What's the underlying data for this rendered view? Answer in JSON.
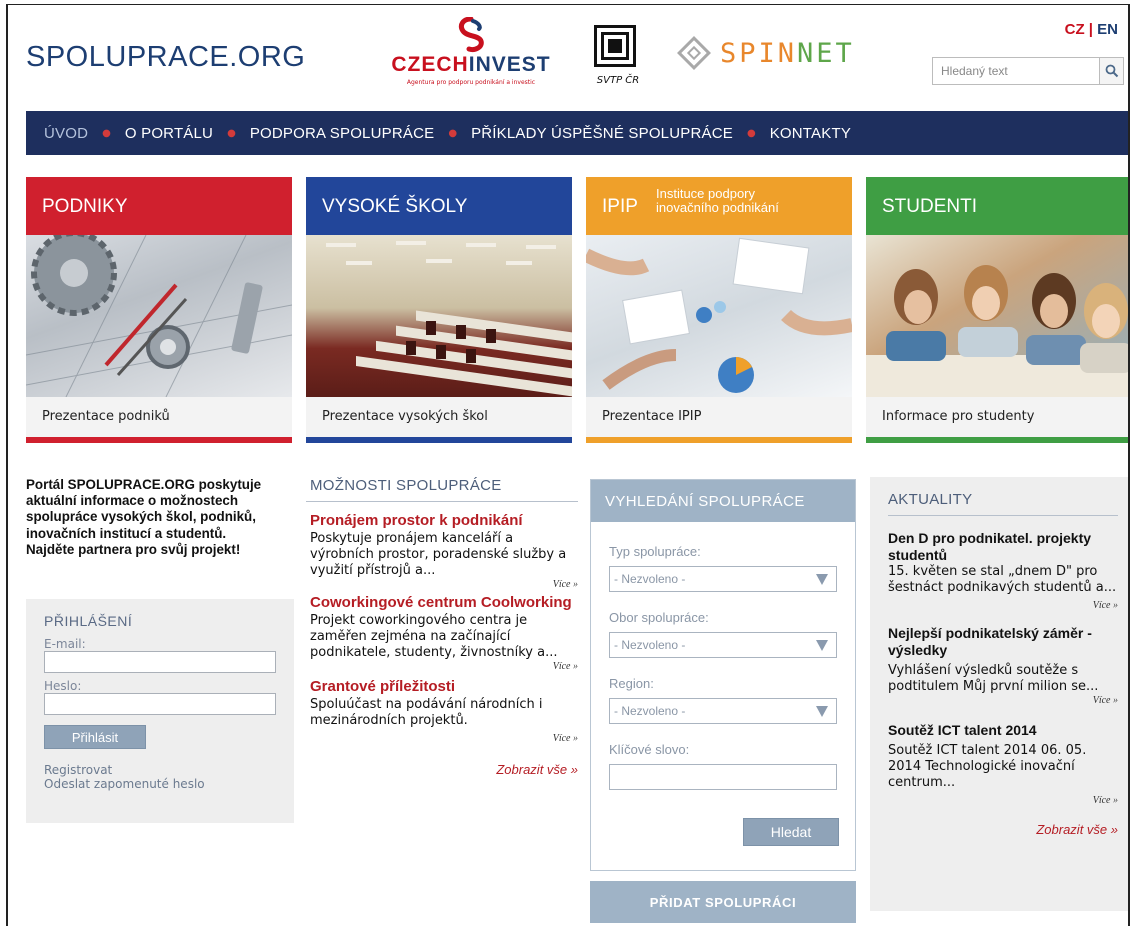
{
  "header": {
    "site_title": "SPOLUPRACE.ORG",
    "czechinvest": {
      "name_a": "CZECH",
      "name_b": "INVEST",
      "tagline": "Agentura pro podporu podnikání a investic"
    },
    "svtp": {
      "label": "SVTP ČR"
    },
    "spinnet": {
      "a": "SPIN",
      "b": "NET"
    },
    "lang": {
      "cz": "CZ",
      "sep": "|",
      "en": "EN"
    },
    "search": {
      "placeholder": "Hledaný text"
    }
  },
  "nav": {
    "items": [
      {
        "label": "ÚVOD"
      },
      {
        "label": "O PORTÁLU"
      },
      {
        "label": "PODPORA SPOLUPRÁCE"
      },
      {
        "label": "PŘÍKLADY ÚSPĚŠNÉ SPOLUPRÁCE"
      },
      {
        "label": "KONTAKTY"
      }
    ]
  },
  "tiles": [
    {
      "title": "PODNIKY",
      "caption": "Prezentace podniků",
      "color": "#d0202e"
    },
    {
      "title": "VYSOKÉ ŠKOLY",
      "caption": "Prezentace vysokých škol",
      "color": "#22469a"
    },
    {
      "title": "IPIP",
      "subtitle": "Instituce podpory inovačního podnikání",
      "caption": "Prezentace IPIP",
      "color": "#efa02a"
    },
    {
      "title": "STUDENTI",
      "caption": "Informace pro studenty",
      "color": "#3f9e44"
    }
  ],
  "intro": {
    "text": "Portál SPOLUPRACE.ORG poskytuje aktuální informace o možnostech spolupráce vysokých škol, podniků, inovačních institucí a studentů.",
    "cta": "Najděte partnera pro svůj projekt!"
  },
  "login": {
    "title": "PŘIHLÁŠENÍ",
    "email_label": "E-mail:",
    "password_label": "Heslo:",
    "submit": "Přihlásit",
    "register": "Registrovat",
    "forgot": "Odeslat zapomenuté heslo"
  },
  "cooperation": {
    "title": "MOŽNOSTI SPOLUPRÁCE",
    "items": [
      {
        "title": "Pronájem prostor k podnikání",
        "text": "Poskytuje pronájem kanceláří a výrobních prostor, poradenské služby a využití přístrojů a...",
        "more": "Více »"
      },
      {
        "title": "Coworkingové centrum Coolworking",
        "text": "Projekt coworkingového centra je zaměřen zejména na začínající podnikatele, studenty, živnostníky a...",
        "more": "Více »"
      },
      {
        "title": "Grantové příležitosti",
        "text": "Spoluúčast na podávání národních i mezinárodních projektů.",
        "more": "Více »"
      }
    ],
    "show_all": "Zobrazit vše »"
  },
  "search_panel": {
    "title": "VYHLEDÁNÍ SPOLUPRÁCE",
    "type_label": "Typ spolupráce:",
    "type_value": "- Nezvoleno -",
    "field_label": "Obor spolupráce:",
    "field_value": "- Nezvoleno -",
    "region_label": "Region:",
    "region_value": "- Nezvoleno -",
    "keyword_label": "Klíčové slovo:",
    "submit": "Hledat"
  },
  "add_button": "PŘIDAT SPOLUPRÁCI",
  "news": {
    "title": "AKTUALITY",
    "items": [
      {
        "title": "Den D pro podnikatel. projekty studentů",
        "text": "15. květen se stal „dnem D\" pro šestnáct podnikavých studentů a...",
        "more": "Více »"
      },
      {
        "title": "Nejlepší podnikatelský záměr - výsledky",
        "text": "Vyhlášení výsledků soutěže s podtitulem Můj první milion se...",
        "more": "Více »"
      },
      {
        "title": "Soutěž ICT talent 2014",
        "text": "Soutěž ICT talent 2014 06. 05. 2014 Technologické inovační centrum...",
        "more": "Více »"
      }
    ],
    "show_all": "Zobrazit vše »"
  }
}
